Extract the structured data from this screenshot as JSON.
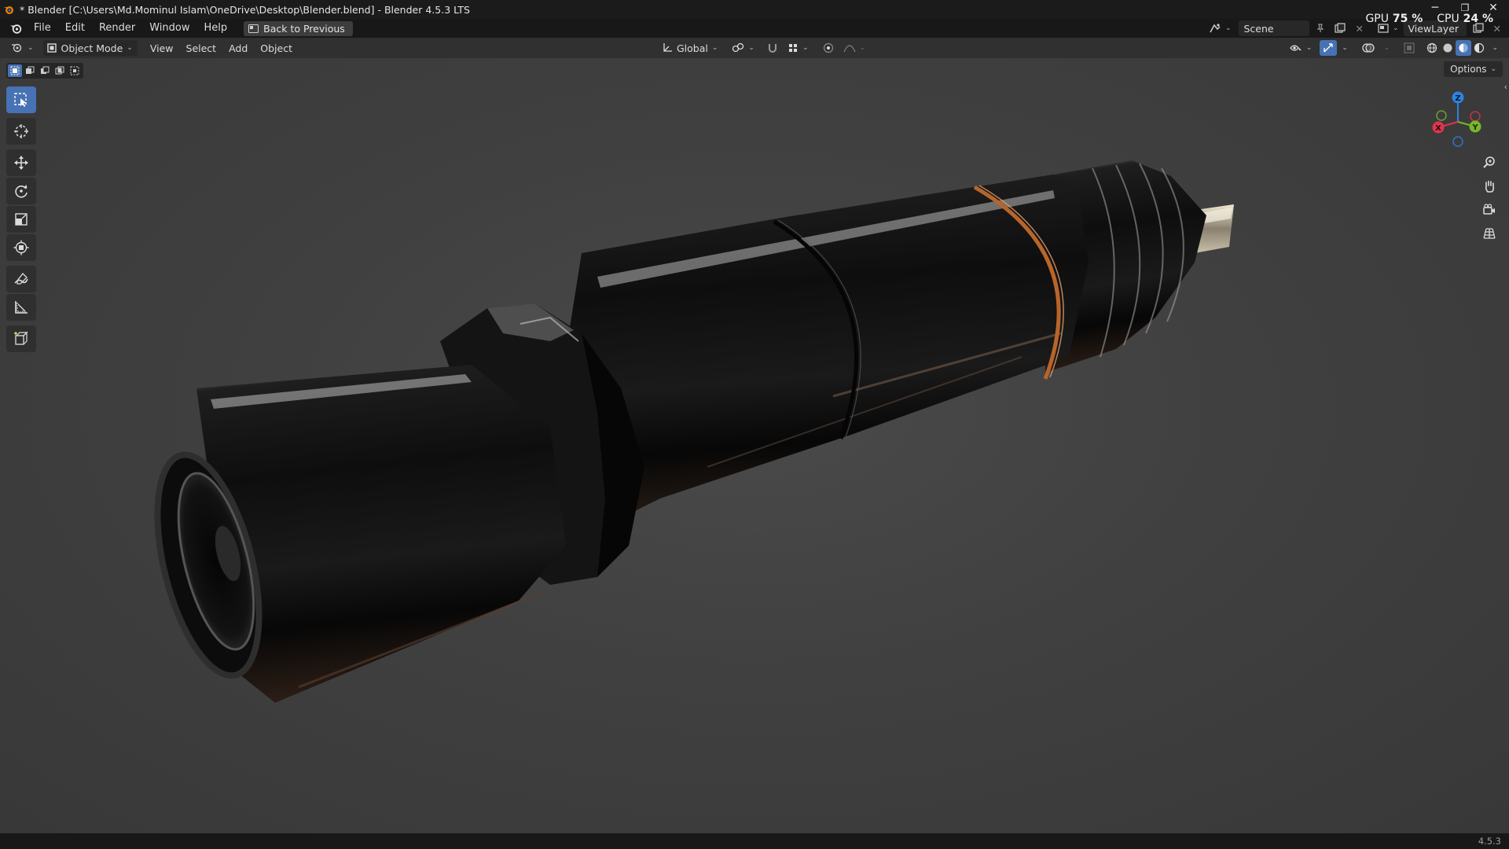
{
  "window": {
    "title": "* Blender [C:\\Users\\Md.Mominul Islam\\OneDrive\\Desktop\\Blender.blend] - Blender 4.5.3 LTS",
    "controls": {
      "minimize": "─",
      "maximize": "❐",
      "close": "✕"
    }
  },
  "menubar": {
    "items": [
      "File",
      "Edit",
      "Render",
      "Window",
      "Help"
    ],
    "back_button": "Back to Previous",
    "scene_field": "Scene",
    "viewlayer_field": "ViewLayer"
  },
  "stats": {
    "gpu_label": "GPU",
    "gpu_value": "75 %",
    "cpu_label": "CPU",
    "cpu_value": "24 %"
  },
  "viewport_header": {
    "mode": "Object Mode",
    "menus": [
      "View",
      "Select",
      "Add",
      "Object"
    ],
    "transform_orientation": "Global"
  },
  "viewport": {
    "options_label": "Options",
    "gizmo_axes": {
      "x": "X",
      "y": "Y",
      "z": "Z"
    },
    "tools": [
      "select-box-icon",
      "cursor-icon",
      "move-icon",
      "rotate-icon",
      "scale-icon",
      "transform-icon",
      "annotate-icon",
      "measure-icon",
      "add-cube-icon"
    ],
    "nav_buttons": [
      "zoom-icon",
      "pan-hand-icon",
      "camera-view-icon",
      "ortho-grid-icon"
    ]
  },
  "statusbar": {
    "version": "4.5.3"
  },
  "colors": {
    "accent": "#4772b3",
    "axis_x": "#e0344e",
    "axis_y": "#78b82a",
    "axis_z": "#2d83e3",
    "copper_ring": "#b8652a"
  }
}
